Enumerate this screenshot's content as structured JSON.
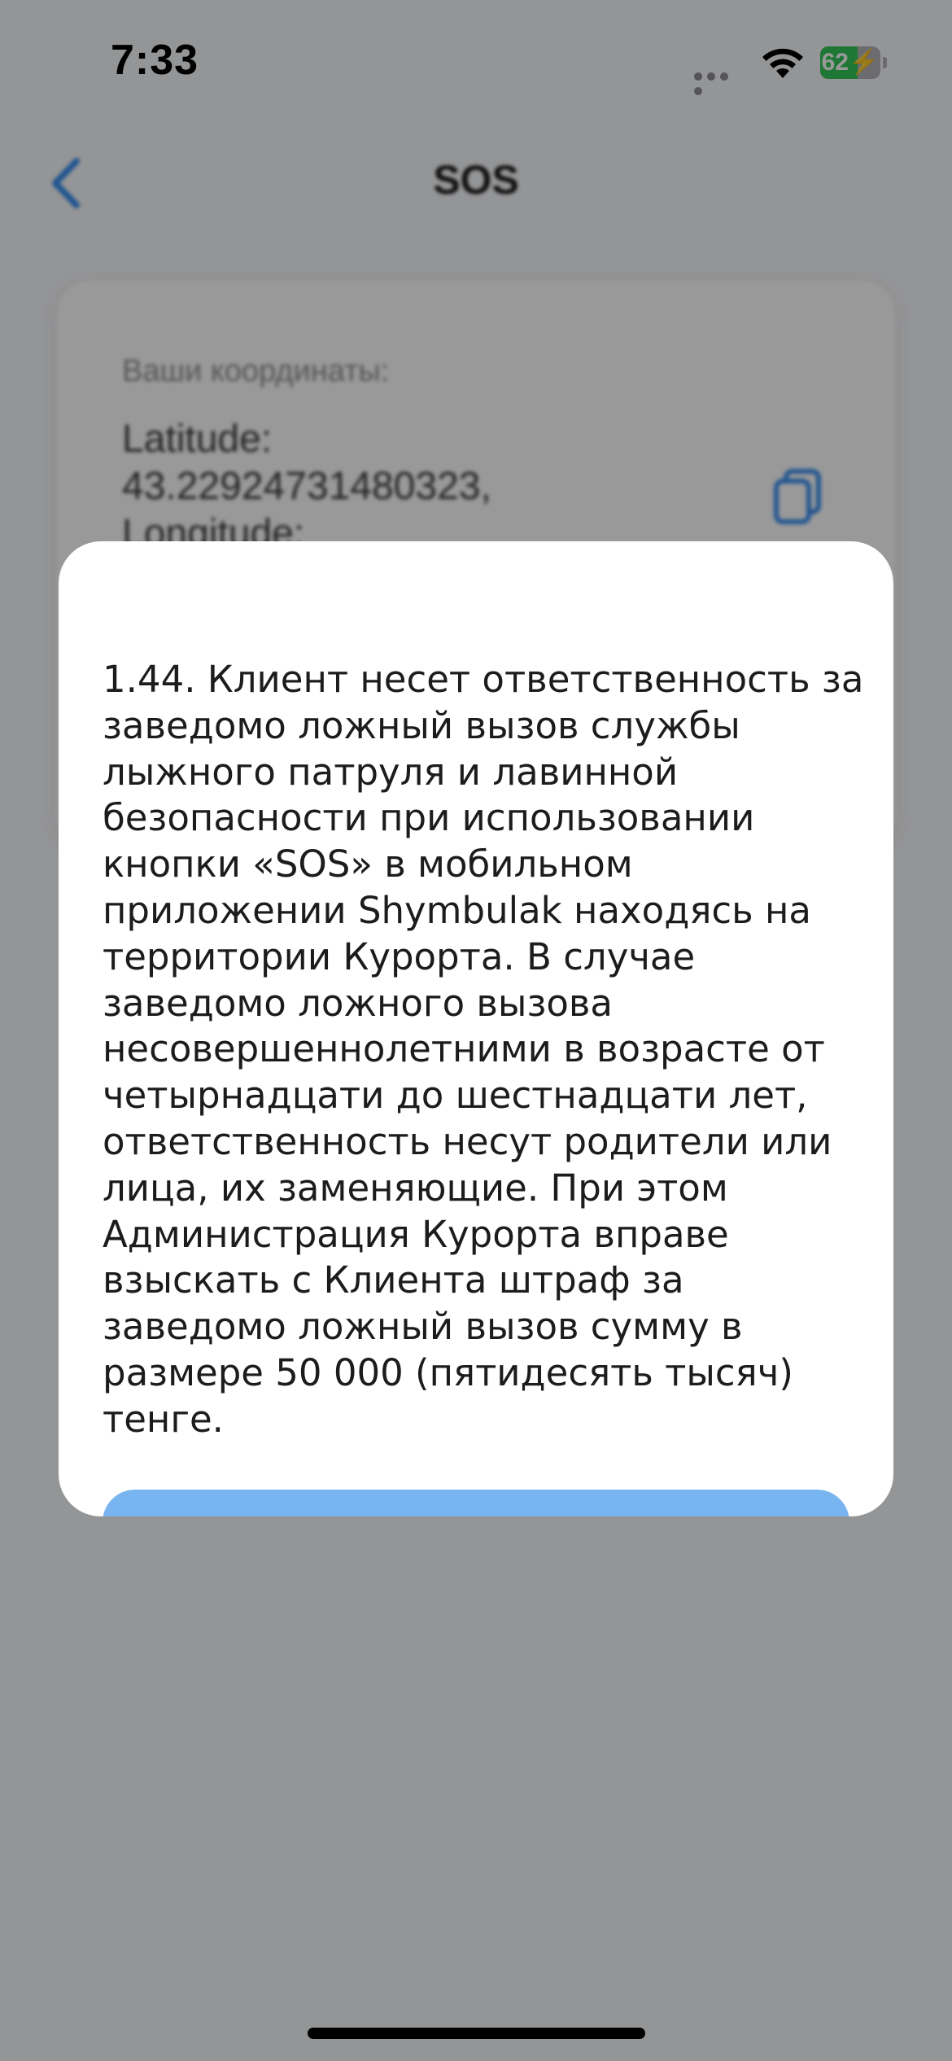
{
  "status_bar": {
    "time": "7:33",
    "battery_level": "62",
    "battery_fraction": 0.62,
    "battery_color": "#34c759",
    "icons": [
      "cellular-dots-icon",
      "wifi-icon",
      "battery-charging-icon"
    ]
  },
  "nav": {
    "title": "SOS",
    "back_icon": "chevron-left-icon",
    "accent_color": "#3b8ff0"
  },
  "coords_card": {
    "label": "Ваши координаты:",
    "value": "Latitude:\n43.22924731480323,\nLongitude:",
    "copy_icon": "copy-icon"
  },
  "modal": {
    "text": "1.44. Клиент несет ответственность за\nзаведомо ложный вызов службы\nлыжного патруля и лавинной\nбезопасности при использовании\nкнопки «SOS» в мобильном\nприложении Shymbulak находясь на\nтерритории Курорта. В случае\nзаведомо ложного вызова\nнесовершеннолетними в возрасте от\nчетырнадцати до шестнадцати лет,\nответственность несут родители или\nлица, их заменяющие. При этом\nАдминистрация Курорта вправе\nвзыскать с Клиента штраф за\nзаведомо ложный вызов сумму в\nразмере 50 000 (пятидесять тысяч)\nтенге.",
    "button_color": "#78b4f0"
  }
}
